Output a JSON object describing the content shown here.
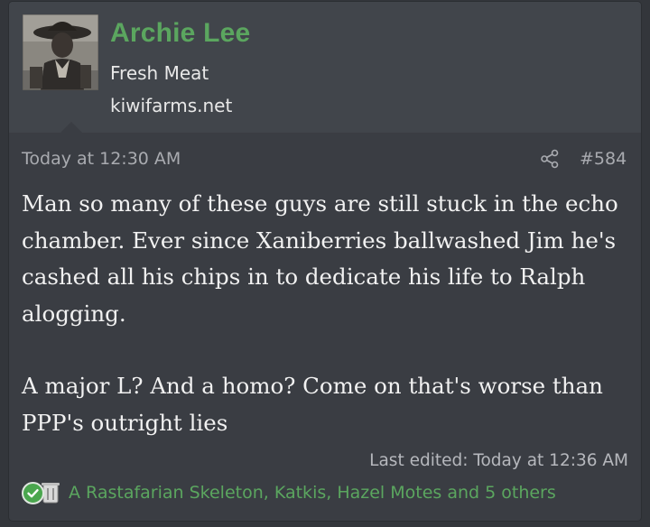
{
  "post": {
    "author": {
      "name": "Archie Lee",
      "title": "Fresh Meat",
      "site": "kiwifarms.net",
      "avatar": "user-avatar-photo"
    },
    "timestamp": "Today at 12:30 AM",
    "share_icon": "share-icon",
    "number": "#584",
    "body": {
      "paragraph_1": "Man so many of these guys are still stuck in the echo chamber. Ever since Xaniberries ballwashed Jim he's cashed all his chips in to dedicate his life to Ralph alogging.",
      "paragraph_2": "A major L? And a homo? Come on that's worse than PPP's outright lies"
    },
    "last_edited": "Last edited: Today at 12:36 AM",
    "reactions": {
      "icons": [
        "checkmark-icon",
        "trash-can-icon"
      ],
      "summary": "A Rastafarian Skeleton, Katkis, Hazel Motes and 5 others"
    }
  },
  "colors": {
    "background": "#33363b",
    "card": "#3a3d43",
    "header": "#41454b",
    "username": "#5ba65f",
    "reaction_link": "#5ba65f",
    "meta_text": "#a9abb0",
    "body_text": "#f1f1f1"
  }
}
